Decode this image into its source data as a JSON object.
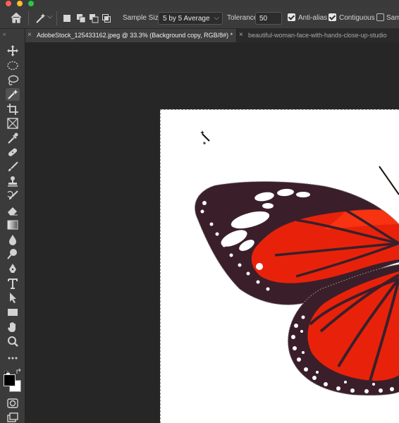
{
  "window": {
    "traffic_lights": {
      "close": "#ff5f57",
      "minimize": "#febc2e",
      "zoom": "#28c840"
    }
  },
  "options_bar": {
    "home_icon": "home-icon",
    "tool_preset_icon": "magic-wand-icon",
    "selection_modes": [
      "new-selection-icon",
      "add-to-selection-icon",
      "subtract-from-selection-icon",
      "intersect-selection-icon"
    ],
    "sample_size_label": "Sample Size:",
    "sample_size_value": "5 by 5 Average",
    "tolerance_label": "Tolerance:",
    "tolerance_value": "50",
    "anti_alias": {
      "label": "Anti-alias",
      "checked": true
    },
    "contiguous": {
      "label": "Contiguous",
      "checked": true
    },
    "sample_all_layers": {
      "label": "Samp",
      "checked": false
    }
  },
  "tabs": [
    {
      "label": "AdobeStock_125433162.jpeg @ 33.3% (Background copy, RGB/8#) *",
      "active": true
    },
    {
      "label": "beautiful-woman-face-with-hands-close-up-studio",
      "active": false
    }
  ],
  "toolbox": {
    "tools": [
      "move-tool-icon",
      "marquee-tool-icon",
      "lasso-tool-icon",
      "magic-wand-tool-icon",
      "crop-tool-icon",
      "frame-tool-icon",
      "eyedropper-tool-icon",
      "healing-brush-tool-icon",
      "brush-tool-icon",
      "clone-stamp-tool-icon",
      "history-brush-tool-icon",
      "eraser-tool-icon",
      "gradient-tool-icon",
      "blur-tool-icon",
      "dodge-tool-icon",
      "pen-tool-icon",
      "type-tool-icon",
      "path-selection-tool-icon",
      "rectangle-tool-icon",
      "hand-tool-icon",
      "zoom-tool-icon",
      "more-tools-icon"
    ],
    "selected_tool": "magic-wand-tool-icon",
    "foreground_color": "#000000",
    "background_color": "#ffffff"
  },
  "canvas": {
    "document_background": "#ffffff",
    "workspace_background": "#262626",
    "butterfly_orange": "#e8220a",
    "butterfly_dark": "#3a1f2b"
  }
}
